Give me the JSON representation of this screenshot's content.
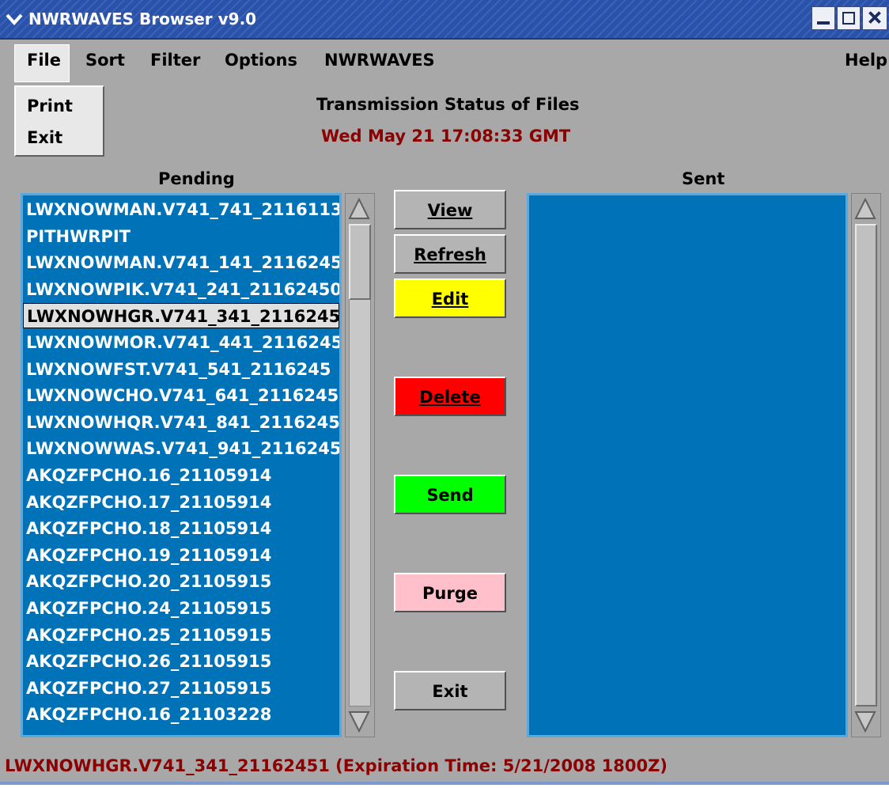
{
  "window": {
    "title": "NWRWAVES Browser v9.0"
  },
  "menubar": {
    "file": "File",
    "sort": "Sort",
    "filter": "Filter",
    "options": "Options",
    "nwrwaves": "NWRWAVES",
    "help": "Help"
  },
  "file_menu": {
    "items": [
      "Print",
      "Exit"
    ]
  },
  "header": {
    "title": "Transmission Status of Files",
    "datetime": "Wed May 21  17:08:33 GMT"
  },
  "pending": {
    "label": "Pending",
    "selected_index": 4,
    "items": [
      "LWXNOWMAN.V741_741_2116113",
      "PITHWRPIT",
      "LWXNOWMAN.V741_141_2116245",
      "LWXNOWPIK.V741_241_21162450",
      "LWXNOWHGR.V741_341_2116245",
      "LWXNOWMOR.V741_441_2116245",
      "LWXNOWFST.V741_541_2116245",
      "LWXNOWCHO.V741_641_2116245",
      "LWXNOWHQR.V741_841_2116245",
      "LWXNOWWAS.V741_941_2116245",
      "AKQZFPCHO.16_21105914",
      "AKQZFPCHO.17_21105914",
      "AKQZFPCHO.18_21105914",
      "AKQZFPCHO.19_21105914",
      "AKQZFPCHO.20_21105915",
      "AKQZFPCHO.24_21105915",
      "AKQZFPCHO.25_21105915",
      "AKQZFPCHO.26_21105915",
      "AKQZFPCHO.27_21105915",
      "AKQZFPCHO.16_21103228"
    ]
  },
  "sent": {
    "label": "Sent",
    "items": []
  },
  "buttons": {
    "view": "View",
    "refresh": "Refresh",
    "edit": "Edit",
    "delete": "Delete",
    "send": "Send",
    "purge": "Purge",
    "exit": "Exit"
  },
  "colors": {
    "list_bg": "#0073b8",
    "edit": "#ffff00",
    "delete": "#ff0000",
    "send": "#00ff00",
    "purge": "#ffc0cb",
    "status_text": "#8b0000"
  },
  "status_bar": "LWXNOWHGR.V741_341_21162451 (Expiration Time: 5/21/2008 1800Z)"
}
